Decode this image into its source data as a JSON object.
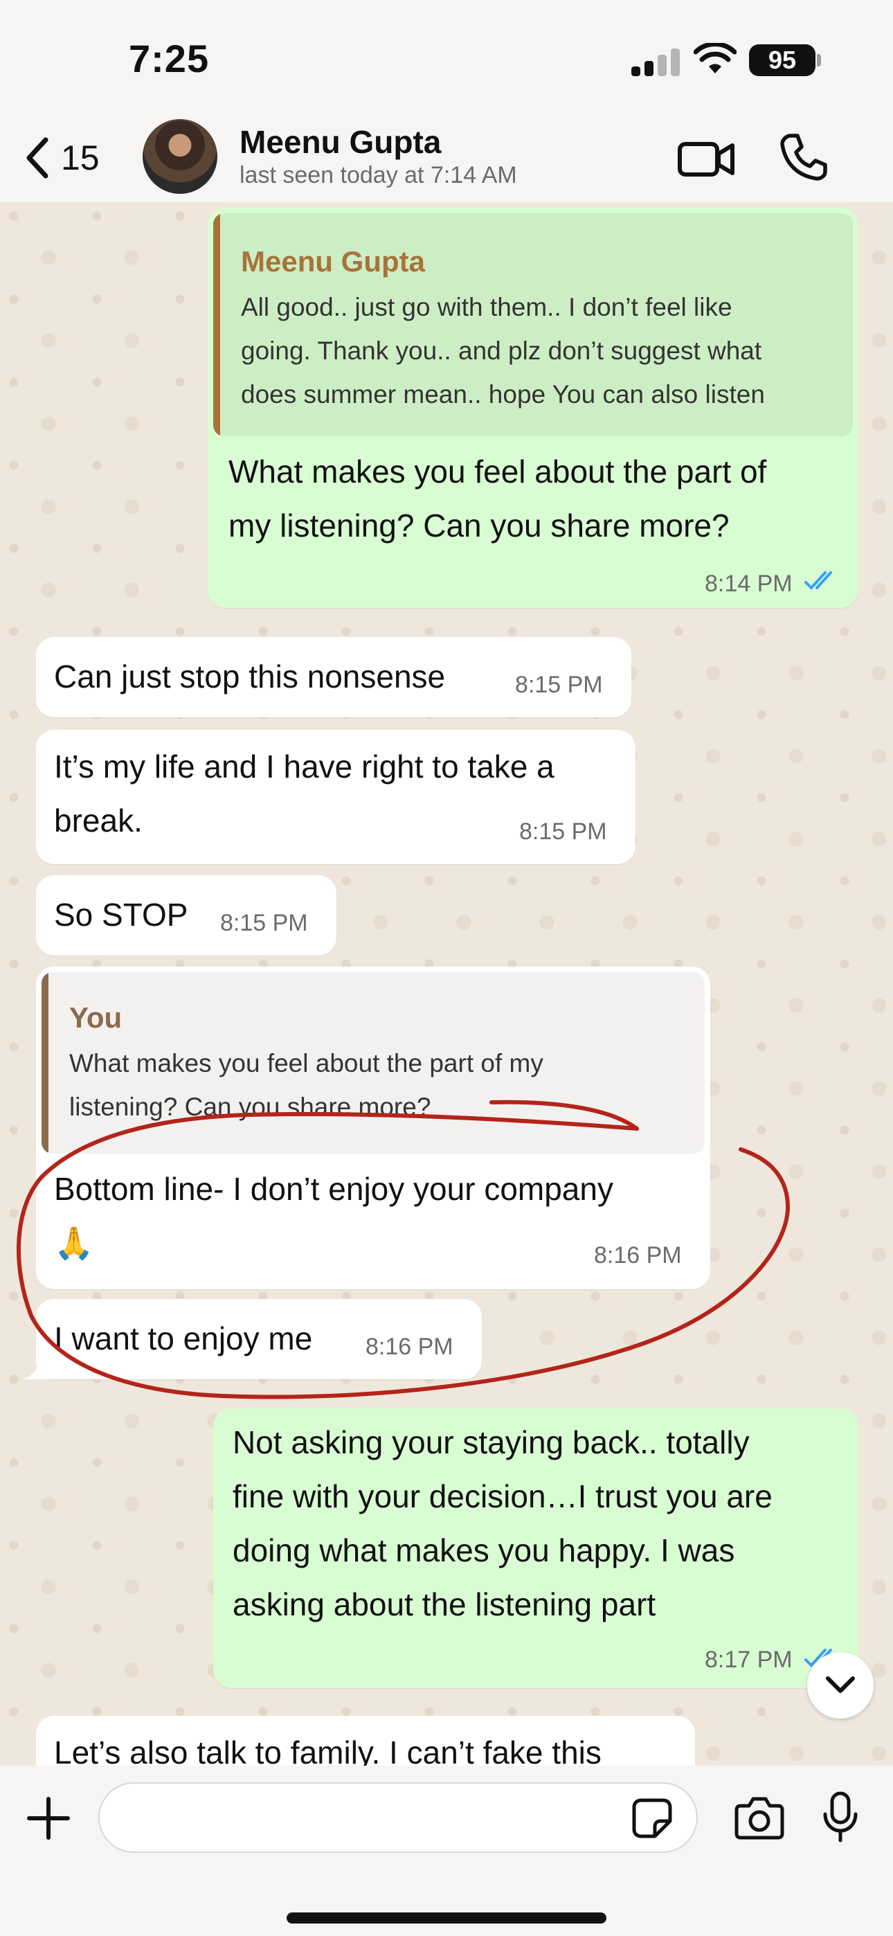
{
  "status_bar": {
    "time": "7:25",
    "battery": "95"
  },
  "header": {
    "back_count": "15",
    "contact_name": "Meenu Gupta",
    "contact_status": "last seen today at 7:14 AM"
  },
  "messages": [
    {
      "direction": "out",
      "quote": {
        "author": "Meenu Gupta",
        "lines": [
          "All good.. just go with them.. I don’t feel like",
          "going. Thank you.. and plz don’t suggest what",
          "does summer mean.. hope You can also listen"
        ]
      },
      "lines": [
        "What makes you feel about the part of",
        "my listening? Can you share more?"
      ],
      "time": "8:14 PM",
      "read": true
    },
    {
      "direction": "in",
      "lines": [
        "Can just stop this nonsense"
      ],
      "time": "8:15 PM"
    },
    {
      "direction": "in",
      "lines": [
        "It’s my life and I have right to take a",
        "break."
      ],
      "time": "8:15 PM"
    },
    {
      "direction": "in",
      "lines": [
        "So STOP"
      ],
      "time": "8:15 PM"
    },
    {
      "direction": "in",
      "quote": {
        "author": "You",
        "lines": [
          "What makes you feel about the part of my",
          "listening? Can you share more?"
        ]
      },
      "lines": [
        "Bottom line- I don’t enjoy your company",
        "🙏"
      ],
      "time": "8:16 PM"
    },
    {
      "direction": "in",
      "lines": [
        "I want to enjoy me"
      ],
      "time": "8:16 PM"
    },
    {
      "direction": "out",
      "lines": [
        "Not asking your staying back.. totally",
        "fine with your decision…I trust you are",
        "doing what makes you happy. I was",
        "asking about the listening part"
      ],
      "time": "8:17 PM",
      "read": true
    },
    {
      "direction": "in",
      "lines": [
        "Let’s also talk to family. I can’t fake this"
      ],
      "time": ""
    }
  ],
  "composer": {
    "placeholder": ""
  },
  "colors": {
    "outgoing_bubble": "#d9fdd3",
    "incoming_bubble": "#ffffff",
    "annotation_red": "#b3241a",
    "read_ticks": "#3a9ef5",
    "quote_author_meenu": "#a8733a",
    "quote_author_you": "#8a6b4e"
  },
  "icons": [
    "chevron-left-icon",
    "video-call-icon",
    "phone-icon",
    "plus-icon",
    "sticker-icon",
    "camera-icon",
    "microphone-icon",
    "chevron-down-icon",
    "double-check-icon"
  ]
}
